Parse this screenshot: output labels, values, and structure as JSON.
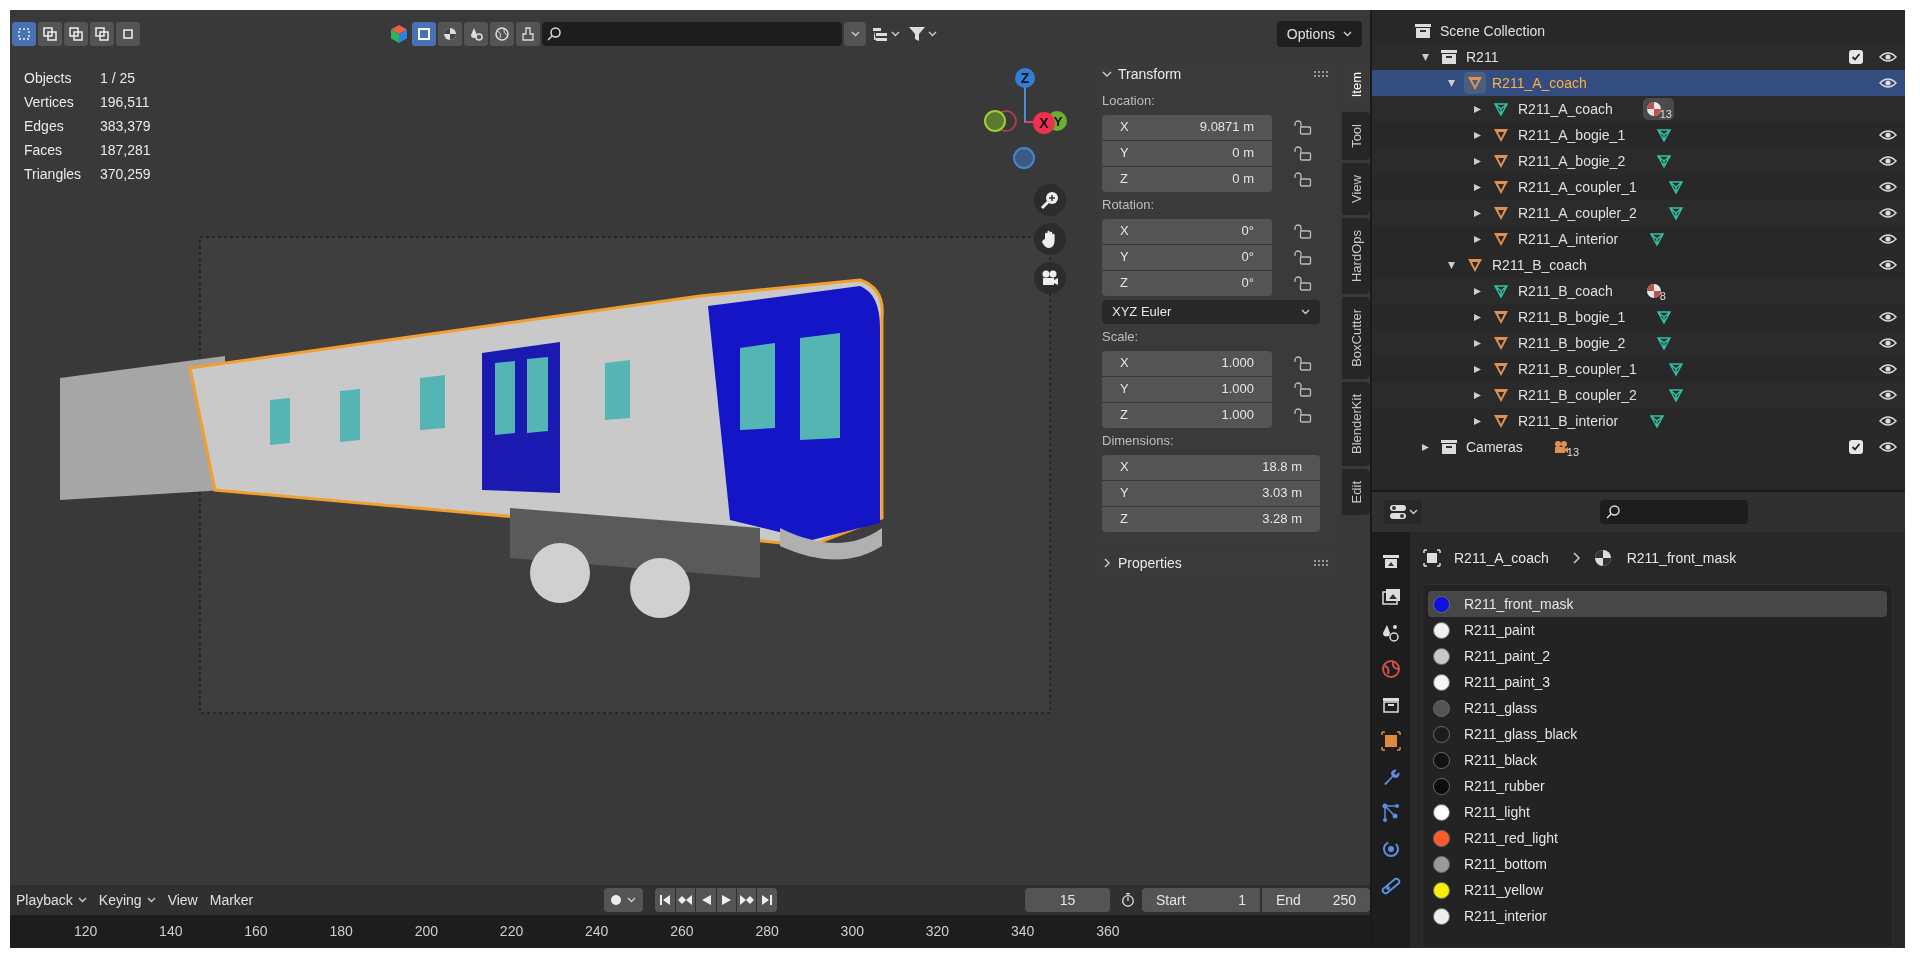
{
  "header": {
    "select_modes": [
      {
        "selected": true
      },
      {
        "selected": false
      },
      {
        "selected": false
      },
      {
        "selected": false
      },
      {
        "selected": false
      }
    ],
    "view_modes": [
      {
        "selected": true
      },
      {
        "selected": false
      },
      {
        "selected": false
      },
      {
        "selected": false
      },
      {
        "selected": false
      }
    ],
    "options": "Options"
  },
  "stats": [
    {
      "label": "Objects",
      "value": "1 / 25"
    },
    {
      "label": "Vertices",
      "value": "196,511"
    },
    {
      "label": "Edges",
      "value": "383,379"
    },
    {
      "label": "Faces",
      "value": "187,281"
    },
    {
      "label": "Triangles",
      "value": "370,259"
    }
  ],
  "gizmo": {
    "z": "Z",
    "x": "X",
    "y": "Y"
  },
  "n_panel": {
    "tabs": [
      {
        "label": "Item",
        "selected": true
      },
      {
        "label": "Tool",
        "selected": false
      },
      {
        "label": "View",
        "selected": false
      },
      {
        "label": "HardOps",
        "selected": false
      },
      {
        "label": "BoxCutter",
        "selected": false
      },
      {
        "label": "BlenderKit",
        "selected": false
      },
      {
        "label": "Edit",
        "selected": false
      }
    ],
    "transform": {
      "title": "Transform",
      "expanded": true,
      "sections": [
        {
          "kind": "group",
          "label": "Location:",
          "fields": [
            {
              "axis": "X",
              "value": "9.0871 m",
              "locked": false
            },
            {
              "axis": "Y",
              "value": "0 m",
              "locked": false
            },
            {
              "axis": "Z",
              "value": "0 m",
              "locked": false
            }
          ]
        },
        {
          "kind": "group",
          "label": "Rotation:",
          "fields": [
            {
              "axis": "X",
              "value": "0°",
              "locked": false
            },
            {
              "axis": "Y",
              "value": "0°",
              "locked": false
            },
            {
              "axis": "Z",
              "value": "0°",
              "locked": false
            }
          ]
        },
        {
          "kind": "dropdown",
          "value": "XYZ Euler"
        },
        {
          "kind": "group",
          "label": "Scale:",
          "fields": [
            {
              "axis": "X",
              "value": "1.000",
              "locked": false
            },
            {
              "axis": "Y",
              "value": "1.000",
              "locked": false
            },
            {
              "axis": "Z",
              "value": "1.000",
              "locked": false
            }
          ]
        },
        {
          "kind": "group",
          "label": "Dimensions:",
          "fields": [
            {
              "axis": "X",
              "value": "18.8 m"
            },
            {
              "axis": "Y",
              "value": "3.03 m"
            },
            {
              "axis": "Z",
              "value": "3.28 m"
            }
          ]
        }
      ]
    },
    "properties": {
      "title": "Properties",
      "expanded": false
    }
  },
  "timeline": {
    "menus": [
      {
        "label": "Playback",
        "dropdown": true
      },
      {
        "label": "Keying",
        "dropdown": true
      },
      {
        "label": "View",
        "dropdown": false
      },
      {
        "label": "Marker",
        "dropdown": false
      }
    ],
    "current_frame": "15",
    "start_label": "Start",
    "start": "1",
    "end_label": "End",
    "end": "250",
    "ticks": [
      "120",
      "140",
      "160",
      "180",
      "200",
      "220",
      "240",
      "260",
      "280",
      "300",
      "320",
      "340",
      "360"
    ]
  },
  "outliner": {
    "items": [
      {
        "name": "Scene Collection",
        "kind": "scene",
        "selected": false,
        "children": [
          {
            "name": "R211",
            "kind": "collection",
            "expanded": true,
            "selected": false,
            "checked": true,
            "visible": true,
            "children": [
              {
                "name": "R211_A_coach",
                "kind": "object",
                "expanded": true,
                "selected": true,
                "visible": true,
                "children": [
                  {
                    "name": "R211_A_coach",
                    "kind": "mesh",
                    "expanded": false,
                    "selected": false,
                    "badge": {
                      "kind": "material",
                      "count": "13",
                      "highlighted": true
                    }
                  },
                  {
                    "name": "R211_A_bogie_1",
                    "kind": "object",
                    "expanded": false,
                    "selected": false,
                    "visible": true,
                    "badge": {
                      "kind": "mesh"
                    }
                  },
                  {
                    "name": "R211_A_bogie_2",
                    "kind": "object",
                    "expanded": false,
                    "selected": false,
                    "visible": true,
                    "badge": {
                      "kind": "mesh"
                    }
                  },
                  {
                    "name": "R211_A_coupler_1",
                    "kind": "object",
                    "expanded": false,
                    "selected": false,
                    "visible": true,
                    "badge": {
                      "kind": "mesh"
                    }
                  },
                  {
                    "name": "R211_A_coupler_2",
                    "kind": "object",
                    "expanded": false,
                    "selected": false,
                    "visible": true,
                    "badge": {
                      "kind": "mesh"
                    }
                  },
                  {
                    "name": "R211_A_interior",
                    "kind": "object",
                    "expanded": false,
                    "selected": false,
                    "visible": true,
                    "badge": {
                      "kind": "mesh"
                    }
                  }
                ]
              },
              {
                "name": "R211_B_coach",
                "kind": "object",
                "expanded": true,
                "selected": false,
                "visible": true,
                "children": [
                  {
                    "name": "R211_B_coach",
                    "kind": "mesh",
                    "expanded": false,
                    "selected": false,
                    "badge": {
                      "kind": "material",
                      "count": "8",
                      "highlighted": false
                    }
                  },
                  {
                    "name": "R211_B_bogie_1",
                    "kind": "object",
                    "expanded": false,
                    "selected": false,
                    "visible": true,
                    "badge": {
                      "kind": "mesh"
                    }
                  },
                  {
                    "name": "R211_B_bogie_2",
                    "kind": "object",
                    "expanded": false,
                    "selected": false,
                    "visible": true,
                    "badge": {
                      "kind": "mesh"
                    }
                  },
                  {
                    "name": "R211_B_coupler_1",
                    "kind": "object",
                    "expanded": false,
                    "selected": false,
                    "visible": true,
                    "badge": {
                      "kind": "mesh"
                    }
                  },
                  {
                    "name": "R211_B_coupler_2",
                    "kind": "object",
                    "expanded": false,
                    "selected": false,
                    "visible": true,
                    "badge": {
                      "kind": "mesh"
                    }
                  },
                  {
                    "name": "R211_B_interior",
                    "kind": "object",
                    "expanded": false,
                    "selected": false,
                    "visible": true,
                    "badge": {
                      "kind": "mesh"
                    }
                  }
                ]
              }
            ]
          },
          {
            "name": "Cameras",
            "kind": "collection",
            "expanded": false,
            "selected": false,
            "checked": true,
            "visible": true,
            "badge": {
              "kind": "camera",
              "count": "13"
            }
          }
        ]
      }
    ]
  },
  "properties": {
    "breadcrumb": [
      "R211_A_coach",
      "R211_front_mask"
    ],
    "materials": [
      {
        "name": "R211_front_mask",
        "color": "#1010e0",
        "selected": true
      },
      {
        "name": "R211_paint",
        "color": "#f0f0f0",
        "selected": false
      },
      {
        "name": "R211_paint_2",
        "color": "#c8c8c8",
        "selected": false
      },
      {
        "name": "R211_paint_3",
        "color": "#f4f4f4",
        "selected": false
      },
      {
        "name": "R211_glass",
        "color": "#555555",
        "selected": false
      },
      {
        "name": "R211_glass_black",
        "color": "#1c1c1c",
        "selected": false
      },
      {
        "name": "R211_black",
        "color": "#111111",
        "selected": false
      },
      {
        "name": "R211_rubber",
        "color": "#0c0c0c",
        "selected": false
      },
      {
        "name": "R211_light",
        "color": "#ffffff",
        "selected": false
      },
      {
        "name": "R211_red_light",
        "color": "#ff5a2a",
        "selected": false
      },
      {
        "name": "R211_bottom",
        "color": "#9a9a9a",
        "selected": false
      },
      {
        "name": "R211_yellow",
        "color": "#f5f000",
        "selected": false
      },
      {
        "name": "R211_interior",
        "color": "#eeeeee",
        "selected": false
      }
    ]
  }
}
